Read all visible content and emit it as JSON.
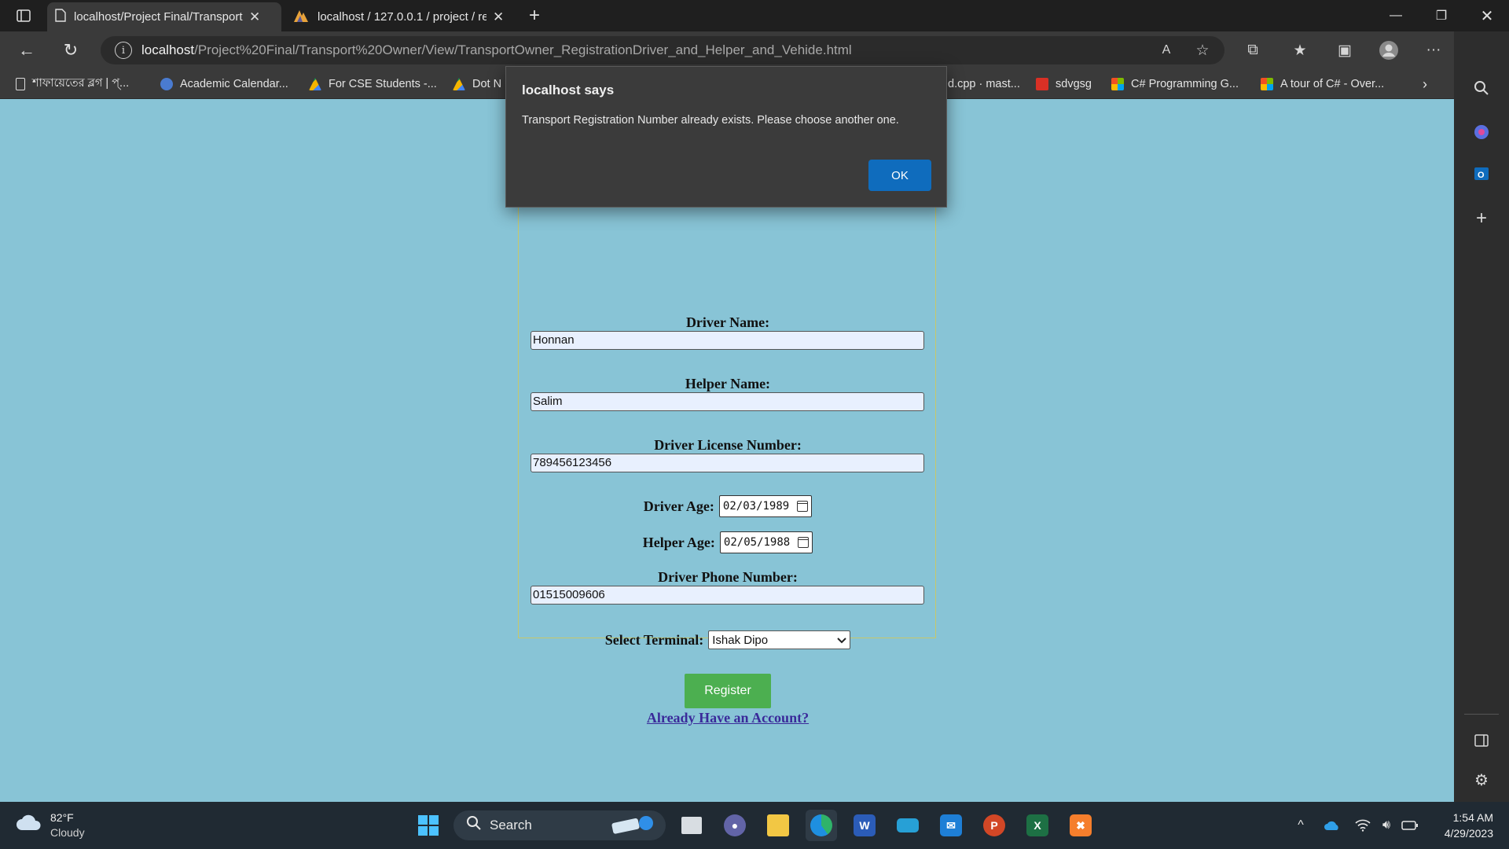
{
  "browser": {
    "tabs": [
      {
        "title": "localhost/Project Final/Transport",
        "active": true
      },
      {
        "title": "localhost / 127.0.0.1 / project / re",
        "active": false
      }
    ],
    "url_host": "localhost",
    "url_path": "/Project%20Final/Transport%20Owner/View/TransportOwner_RegistrationDriver_and_Helper_and_Vehide.html",
    "bookmarks": [
      {
        "label": "শাফায়েতের ব্লগ | প্...",
        "color": "#ffffff"
      },
      {
        "label": "Academic Calendar...",
        "color": "#4a7bd0"
      },
      {
        "label": "For CSE Students -...",
        "color": "#f4b400"
      },
      {
        "label": "Dot N",
        "color": "#f4b400"
      },
      {
        "label": "d.cpp · mast...",
        "color": "#ffffff"
      },
      {
        "label": "sdvgsg",
        "color": "#d93025"
      },
      {
        "label": "C# Programming G...",
        "color": "#f25022"
      },
      {
        "label": "A tour of C# - Over...",
        "color": "#f25022"
      }
    ]
  },
  "dialog": {
    "title": "localhost says",
    "message": "Transport Registration Number already exists. Please choose another one.",
    "ok_label": "OK"
  },
  "form": {
    "driver_name_label": "Driver Name:",
    "driver_name_value": "Honnan",
    "helper_name_label": "Helper Name:",
    "helper_name_value": "Salim",
    "license_label": "Driver License Number:",
    "license_value": "789456123456",
    "driver_age_label": "Driver Age:",
    "driver_age_value": "02/03/1989",
    "helper_age_label": "Helper Age:",
    "helper_age_value": "02/05/1988",
    "phone_label": "Driver Phone Number:",
    "phone_value": "01515009606",
    "terminal_label": "Select Terminal:",
    "terminal_value": "Ishak Dipo",
    "register_label": "Register",
    "account_link": "Already Have an Account?"
  },
  "taskbar": {
    "weather_temp": "82°F",
    "weather_desc": "Cloudy",
    "search_label": "Search",
    "time": "1:54 AM",
    "date": "4/29/2023"
  },
  "icons": [
    "sidebar-toggle-icon",
    "page-icon",
    "close-icon",
    "new-tab-icon",
    "minimize-icon",
    "restore-icon",
    "back-icon",
    "refresh-icon",
    "info-icon",
    "read-aloud-icon",
    "favorite-add-icon",
    "extensions-icon",
    "favorites-icon",
    "collections-icon",
    "profile-icon",
    "more-icon",
    "bing-icon",
    "search-icon",
    "copilot-icon",
    "outlook-icon",
    "add-icon",
    "calendar-icon",
    "chevron-down-icon",
    "windows-icon",
    "wifi-icon",
    "volume-icon",
    "battery-icon",
    "cloud-icon"
  ]
}
